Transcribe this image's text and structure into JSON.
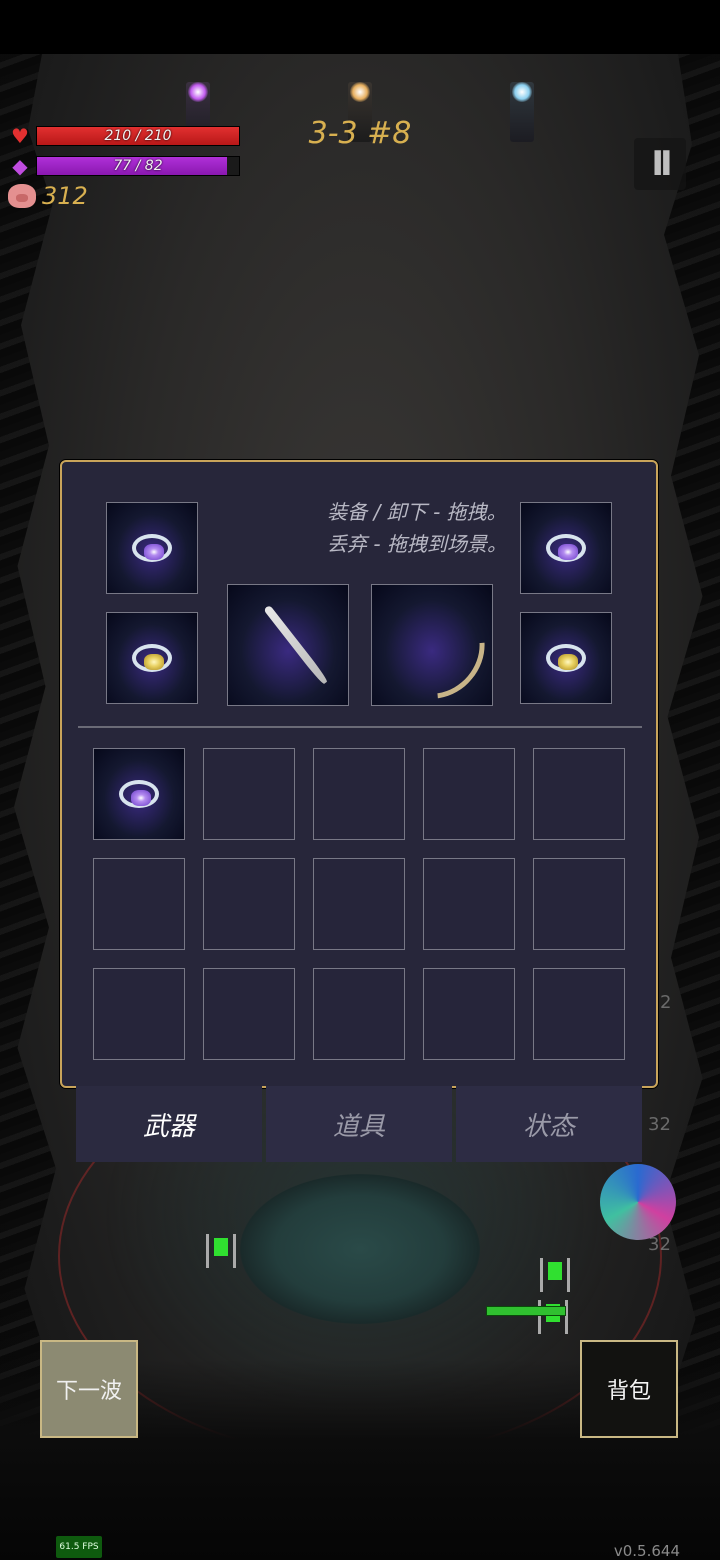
{
  "hud": {
    "hp_text": "210 / 210",
    "mp_text": "77 / 82",
    "gold": "312",
    "wave": "3-3 #8",
    "pause_label": "II"
  },
  "icons": {
    "hp": "heart-icon",
    "mp": "mana-crystal-icon",
    "gold": "piggy-bank-icon",
    "pause": "pause-icon"
  },
  "colors": {
    "hp": "#e23030",
    "mp": "#b030d8",
    "gold_text": "#d8b050",
    "panel_border": "#c9a45a",
    "panel_bg": "#27263a"
  },
  "equipment": {
    "hint_line1": "装备 / 卸下 - 拖拽。",
    "hint_line2": "丢弃 - 拖拽到场景。",
    "slots": {
      "ring_top_left": "purple-wind-ring",
      "ring_bottom_left": "gold-shell-ring",
      "main_weapon": "silver-sword",
      "sub_weapon": "wooden-bow",
      "ring_top_right": "purple-swirl-ring",
      "ring_bottom_right": "gold-shell-ring"
    }
  },
  "inventory": {
    "items": [
      "purple-flower-ring",
      "",
      "",
      "",
      "",
      "",
      "",
      "",
      "",
      "",
      "",
      "",
      "",
      "",
      ""
    ]
  },
  "tabs": [
    {
      "label": "武器",
      "active": true
    },
    {
      "label": "道具",
      "active": false
    },
    {
      "label": "状态",
      "active": false
    }
  ],
  "buttons": {
    "next_wave": "下一波",
    "backpack": "背包"
  },
  "side_numbers": [
    "2",
    "32",
    "32"
  ],
  "footer": {
    "fps": "61.5 FPS",
    "version": "v0.5.644"
  }
}
